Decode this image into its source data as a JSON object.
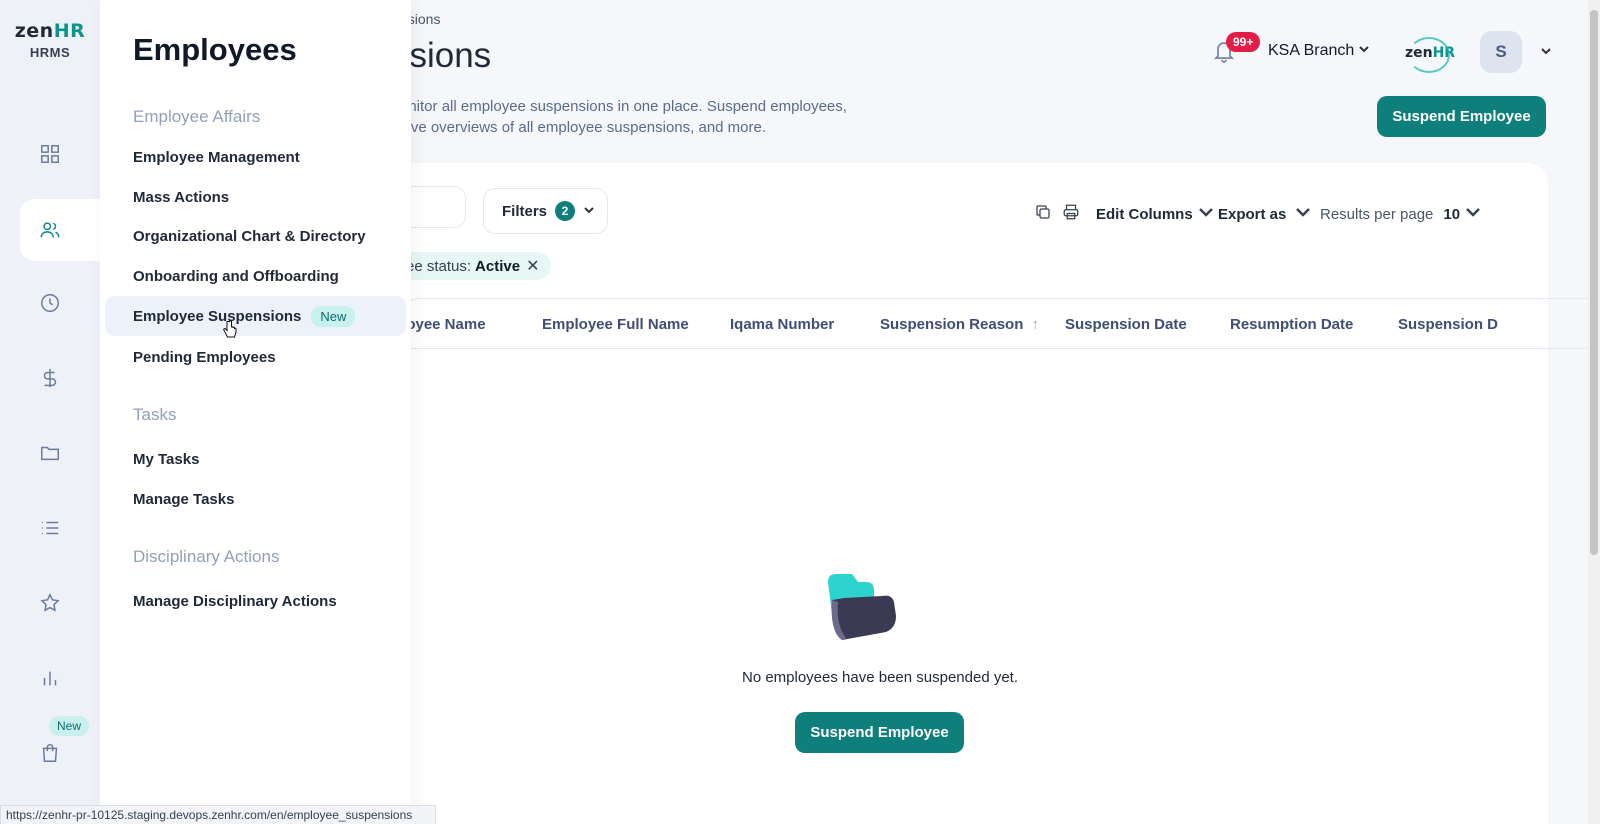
{
  "brand": {
    "logo_text_a": "zen",
    "logo_text_b": "HR",
    "subtitle": "HRMS"
  },
  "rail": {
    "items": [
      "dashboard",
      "employees",
      "time",
      "payroll",
      "documents",
      "lists",
      "favorites",
      "reports",
      "store"
    ],
    "new_badge": "New"
  },
  "flyout": {
    "title": "Employees",
    "sections": [
      {
        "label": "Employee Affairs"
      },
      {
        "label": "Tasks"
      },
      {
        "label": "Disciplinary Actions"
      }
    ],
    "items": [
      {
        "label": "Employee Management"
      },
      {
        "label": "Mass Actions"
      },
      {
        "label": "Organizational Chart & Directory"
      },
      {
        "label": "Onboarding and Offboarding"
      },
      {
        "label": "Employee Suspensions",
        "badge": "New",
        "active": true
      },
      {
        "label": "Pending Employees"
      },
      {
        "label": "My Tasks"
      },
      {
        "label": "Manage Tasks"
      },
      {
        "label": "Manage Disciplinary Actions"
      }
    ]
  },
  "header": {
    "breadcrumb": "nsions",
    "title": "nsions",
    "description": "onitor all employee suspensions in one place. Suspend employees, sive overviews of all employee suspensions, and more.",
    "notification_count": "99+",
    "branch": "KSA Branch",
    "company_logo_a": "zen",
    "company_logo_b": "HR",
    "avatar_initial": "S",
    "suspend_button": "Suspend Employee"
  },
  "toolbar": {
    "filters_label": "Filters",
    "filters_count": "2",
    "chip_prefix": "ee status: ",
    "chip_value": "Active",
    "edit_columns": "Edit Columns",
    "export_as": "Export as",
    "results_per_page_label": "Results per page",
    "results_per_page_value": "10"
  },
  "table": {
    "columns": [
      "ployee Name",
      "Employee Full Name",
      "Iqama Number",
      "Suspension Reason",
      "Suspension Date",
      "Resumption Date",
      "Suspension D"
    ],
    "sorted_column": "Suspension Reason",
    "empty_text": "No employees have been suspended yet.",
    "empty_button": "Suspend Employee"
  },
  "statusbar": {
    "url": "https://zenhr-pr-10125.staging.devops.zenhr.com/en/employee_suspensions"
  },
  "colors": {
    "accent": "#0f7f7c",
    "badge": "#e11d48",
    "chip": "#e7f7f6"
  }
}
